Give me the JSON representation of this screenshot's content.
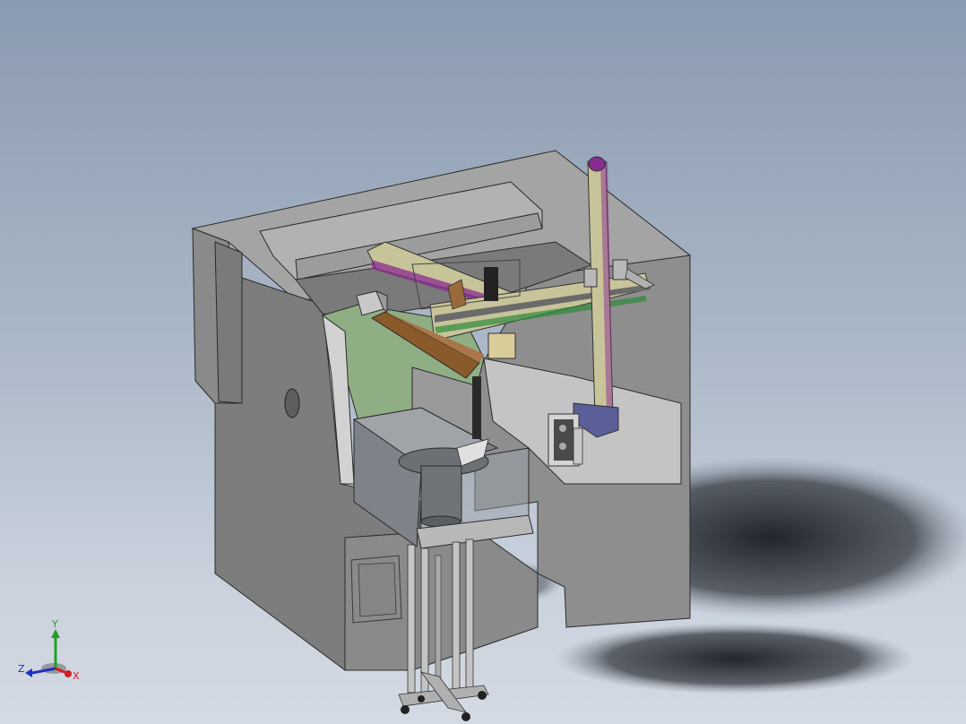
{
  "viewport": {
    "background_top": "#8a9ab0",
    "background_bottom": "#d4dae3"
  },
  "triad": {
    "x_label": "X",
    "y_label": "Y",
    "z_label": "Z",
    "x_color": "#d02020",
    "y_color": "#20a020",
    "z_color": "#2030c0"
  },
  "model": {
    "machine_body_color": "#8c8c8c",
    "interior_panel_color": "#8fae84",
    "gantry_rail_color": "#c8c49a",
    "accent_purple": "#8a2b8f",
    "tray_wood_color": "#8a5a2a",
    "bin_color": "#7f8288"
  }
}
